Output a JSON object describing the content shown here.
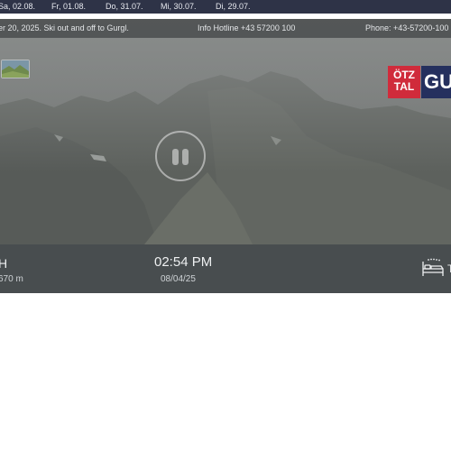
{
  "date_bar": {
    "dates": [
      "Sa, 02.08.",
      "Fr, 01.08.",
      "Do, 31.07.",
      "Mi, 30.07.",
      "Di, 29.07."
    ]
  },
  "info_bar": {
    "news": "er 20, 2025. Ski out and off to Gurgl.",
    "hotline": "Info Hotline +43 57200 100",
    "phone": "Phone: +43-57200-100"
  },
  "logo": {
    "line1": "ÖTZ",
    "line2": "TAL",
    "brand": "GU",
    "colors": {
      "otztal": "#d02b3b",
      "gurgl": "#25305e"
    }
  },
  "player": {
    "state": "paused",
    "control_icon": "pause-icon"
  },
  "bottom_bar": {
    "elevation_label": "H",
    "elevation": "670 m",
    "time": "02:54 PM",
    "date": "08/04/25",
    "hotel_icon": "bed-icon",
    "truncated_text": "T"
  },
  "colors": {
    "date_bar_bg": "#2e3347",
    "bottom_bar_bg": "#484d4f"
  }
}
